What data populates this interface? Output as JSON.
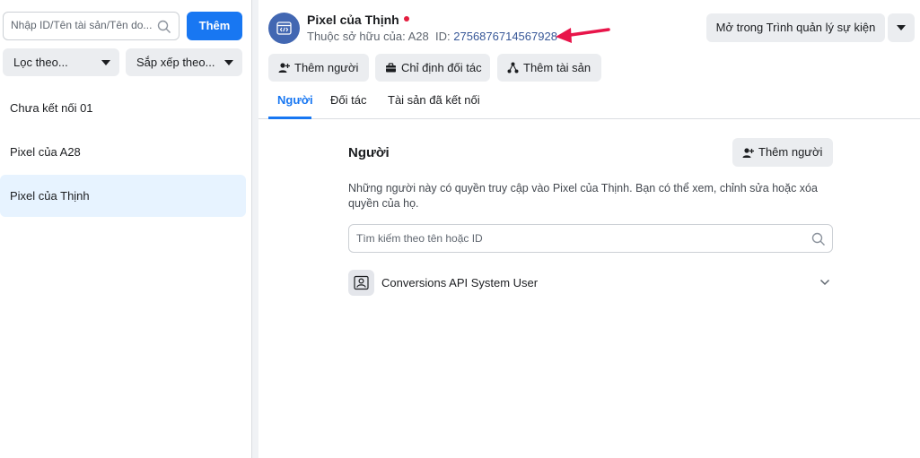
{
  "sidebar": {
    "search_placeholder": "Nhập ID/Tên tài sản/Tên do...",
    "add_label": "Thêm",
    "filter_label": "Lọc theo...",
    "sort_label": "Sắp xếp theo...",
    "items": [
      {
        "label": "Chưa kết nối 01"
      },
      {
        "label": "Pixel của A28"
      },
      {
        "label": "Pixel của Thịnh",
        "selected": true
      }
    ]
  },
  "header": {
    "title": "Pixel của Thịnh",
    "owner_text": "Thuộc sở hữu của: A28",
    "id_label": "ID:",
    "id_value": "2756876714567928",
    "open_button": "Mở trong Trình quản lý sự kiện",
    "actions": {
      "add_person": "Thêm người",
      "assign_partner": "Chỉ định đối tác",
      "add_asset": "Thêm tài sản"
    },
    "tabs": [
      "Người",
      "Đối tác",
      "Tài sản đã kết nối"
    ],
    "active_tab": "Người"
  },
  "people": {
    "title": "Người",
    "add_button": "Thêm người",
    "description": "Những người này có quyền truy cập vào Pixel của Thịnh. Bạn có thể xem, chỉnh sửa hoặc xóa quyền của họ.",
    "search_placeholder": "Tìm kiếm theo tên hoặc ID",
    "list": [
      {
        "name": "Conversions API System User"
      }
    ]
  },
  "colors": {
    "accent": "#1877f2",
    "status_dot": "#e41e3f",
    "arrow": "#e8154a",
    "selected_bg": "#e7f3ff"
  },
  "icons": {
    "search": "search-icon",
    "pixel": "code-window-icon",
    "person_add": "person-add-icon",
    "partner": "briefcase-icon",
    "asset": "network-icon",
    "system_user": "system-user-icon",
    "chevron": "chevron-down-icon"
  }
}
